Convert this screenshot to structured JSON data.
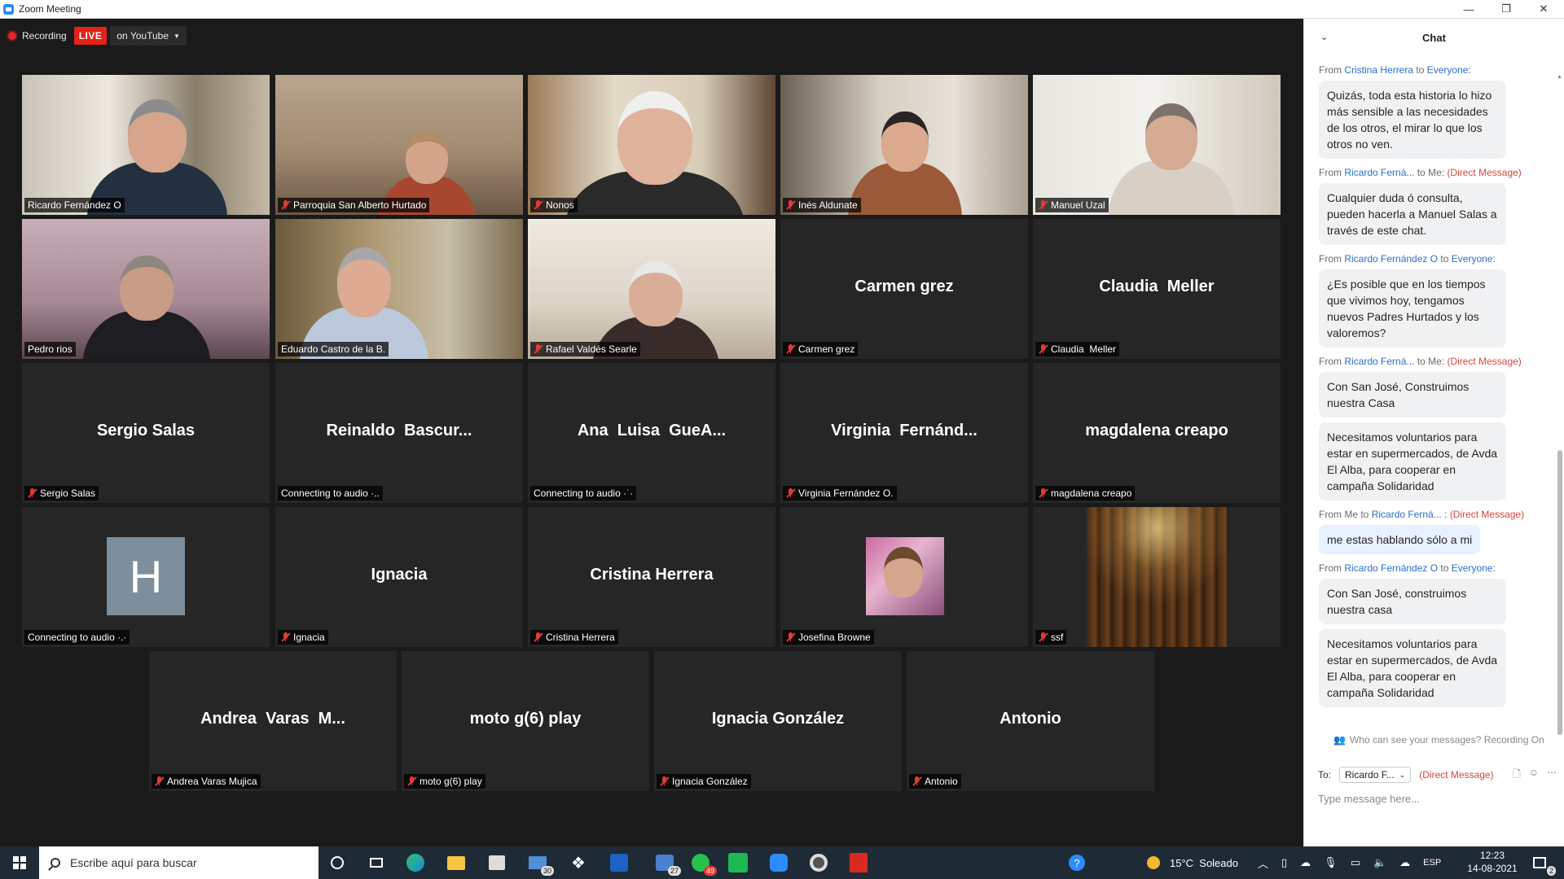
{
  "window": {
    "title": "Zoom Meeting"
  },
  "recording": {
    "label": "Recording",
    "live_badge": "LIVE",
    "platform": "on YouTube"
  },
  "tiles": [
    {
      "name": "Ricardo Fernández O",
      "muted": false,
      "active": true,
      "video": true
    },
    {
      "name": "Parroquia San Alberto Hurtado",
      "muted": true,
      "video": true
    },
    {
      "name": "Nonos",
      "muted": true,
      "video": true
    },
    {
      "name": "Inés Aldunate",
      "muted": true,
      "video": true
    },
    {
      "name": "Manuel Uzal",
      "muted": true,
      "video": true
    },
    {
      "name": "Pedro rios",
      "muted": false,
      "video": true
    },
    {
      "name": "Eduardo Castro de la B.",
      "muted": false,
      "video": true
    },
    {
      "name": "Rafael Valdés Searle",
      "muted": true,
      "video": true
    },
    {
      "center": "Carmen grez",
      "name": "Carmen grez",
      "muted": true
    },
    {
      "center": "Claudia  Meller",
      "name": "Claudia  Meller",
      "muted": true
    },
    {
      "center": "Sergio Salas",
      "name": "Sergio Salas",
      "muted": true
    },
    {
      "center": "Reinaldo  Bascur...",
      "name": "Connecting to audio ·..",
      "muted": false
    },
    {
      "center": "Ana  Luisa  GueA...",
      "name": "Connecting to audio ·˙·",
      "muted": false
    },
    {
      "center": "Virginia  Fernánd...",
      "name": "Virginia Fernández O.",
      "muted": true
    },
    {
      "center": "magdalena creapo",
      "name": "magdalena creapo",
      "muted": true
    },
    {
      "avatar": "H",
      "name": "Connecting to audio ·.·",
      "muted": false
    },
    {
      "center": "Ignacia",
      "name": "Ignacia",
      "muted": true
    },
    {
      "center": "Cristina Herrera",
      "name": "Cristina Herrera",
      "muted": true
    },
    {
      "avatar_photo": true,
      "name": "Josefina Browne",
      "muted": true
    },
    {
      "avatar_library": true,
      "name": "ssf",
      "muted": true
    },
    {
      "center": "Andrea  Varas  M...",
      "name": "Andrea Varas Mujica",
      "muted": true
    },
    {
      "center": "moto g(6) play",
      "name": "moto g(6) play",
      "muted": true
    },
    {
      "center": "Ignacia González",
      "name": "Ignacia González",
      "muted": true
    },
    {
      "center": "Antonio",
      "name": "Antonio",
      "muted": true
    }
  ],
  "chat": {
    "title": "Chat",
    "messages": [
      {
        "from": "Cristina Herrera",
        "to": "Everyone:",
        "dm": "",
        "texts": [
          "Quizás, toda esta historia lo hizo más sensible a las necesidades de los otros, el mirar lo que los otros no ven."
        ]
      },
      {
        "from": "Ricardo Ferná...",
        "to": "Me:",
        "dm": "(Direct Message)",
        "texts": [
          "Cualquier duda ó consulta, pueden hacerla a Manuel Salas a través de este chat."
        ]
      },
      {
        "from": "Ricardo Fernández O",
        "to": "Everyone:",
        "dm": "",
        "texts": [
          "¿Es posible que en los tiempos que vivimos hoy, tengamos nuevos  Padres Hurtados y los valoremos?"
        ]
      },
      {
        "from": "Ricardo Ferná...",
        "to": "Me:",
        "dm": "(Direct Message)",
        "texts": [
          "Con San José, Construimos nuestra Casa",
          "Necesitamos voluntarios para estar en supermercados, de Avda El Alba, para cooperar en campaña Solidaridad"
        ]
      },
      {
        "from": "Me",
        "to": "Ricardo Ferná... :",
        "dm": "(Direct Message)",
        "mine": true,
        "texts": [
          "me estas hablando sólo a mi"
        ]
      },
      {
        "from": "Ricardo Fernández O",
        "to": "Everyone:",
        "dm": "",
        "texts": [
          "Con San José, construimos nuestra casa",
          "Necesitamos voluntarios para estar en supermercados, de Avda El Alba, para cooperar en campaña Solidaridad"
        ]
      }
    ],
    "labels": {
      "from": "From ",
      "to": " to ",
      "who_can_see": "Who can see your messages? Recording On",
      "to_label": "To:"
    },
    "recipient": "Ricardo F...",
    "recipient_dm": "(Direct Message)",
    "input_placeholder": "Type message here..."
  },
  "taskbar": {
    "search_placeholder": "Escribe aquí para buscar",
    "mail_badge": "30",
    "teams_badge": "27",
    "whatsapp_badge": "49",
    "weather": "15°C  Soleado",
    "language": "ESP",
    "time": "12:23",
    "date": "14-08-2021",
    "notifications": "2"
  },
  "colors": {
    "active_speaker": "#e6e34c",
    "live": "#e4221b",
    "muted": "#e53935",
    "chat_blue": "#2d6fd1",
    "chat_red": "#d9463f"
  }
}
